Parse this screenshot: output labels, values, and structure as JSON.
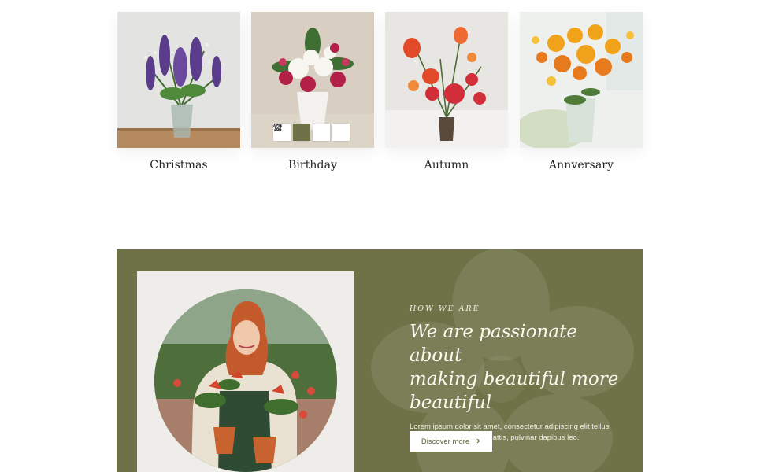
{
  "categories": [
    {
      "label": "Christmas",
      "photo": "purple-lupine-bouquet"
    },
    {
      "label": "Birthday",
      "photo": "white-lily-red-rose-bouquet"
    },
    {
      "label": "Autumn",
      "photo": "orange-tulip-bouquet"
    },
    {
      "label": "Annversary",
      "photo": "orange-ranunculus-bouquet"
    }
  ],
  "card_actions": [
    {
      "icon": "heart-icon"
    },
    {
      "icon": "shopping-bag-icon",
      "active": true
    },
    {
      "icon": "zoom-icon"
    },
    {
      "icon": "shuffle-icon"
    }
  ],
  "about": {
    "eyebrow": "HOW WE ARE",
    "heading_lines": [
      "We are passionate about",
      "making beautiful more",
      "beautiful"
    ],
    "body_lines": [
      "Lorem ipsum dolor sit amet, consectetur adipiscing elit tellus",
      "luctus nec ullamcorper mattis, pulvinar dapibus leo."
    ],
    "cta_label": "Discover more",
    "cta_icon": "arrow-right-icon",
    "photo": "florist-woman-holding-anthurium-pots"
  },
  "colors": {
    "brand_green": "#6e7246",
    "frame": "#efedea",
    "text_dark": "#222222"
  }
}
